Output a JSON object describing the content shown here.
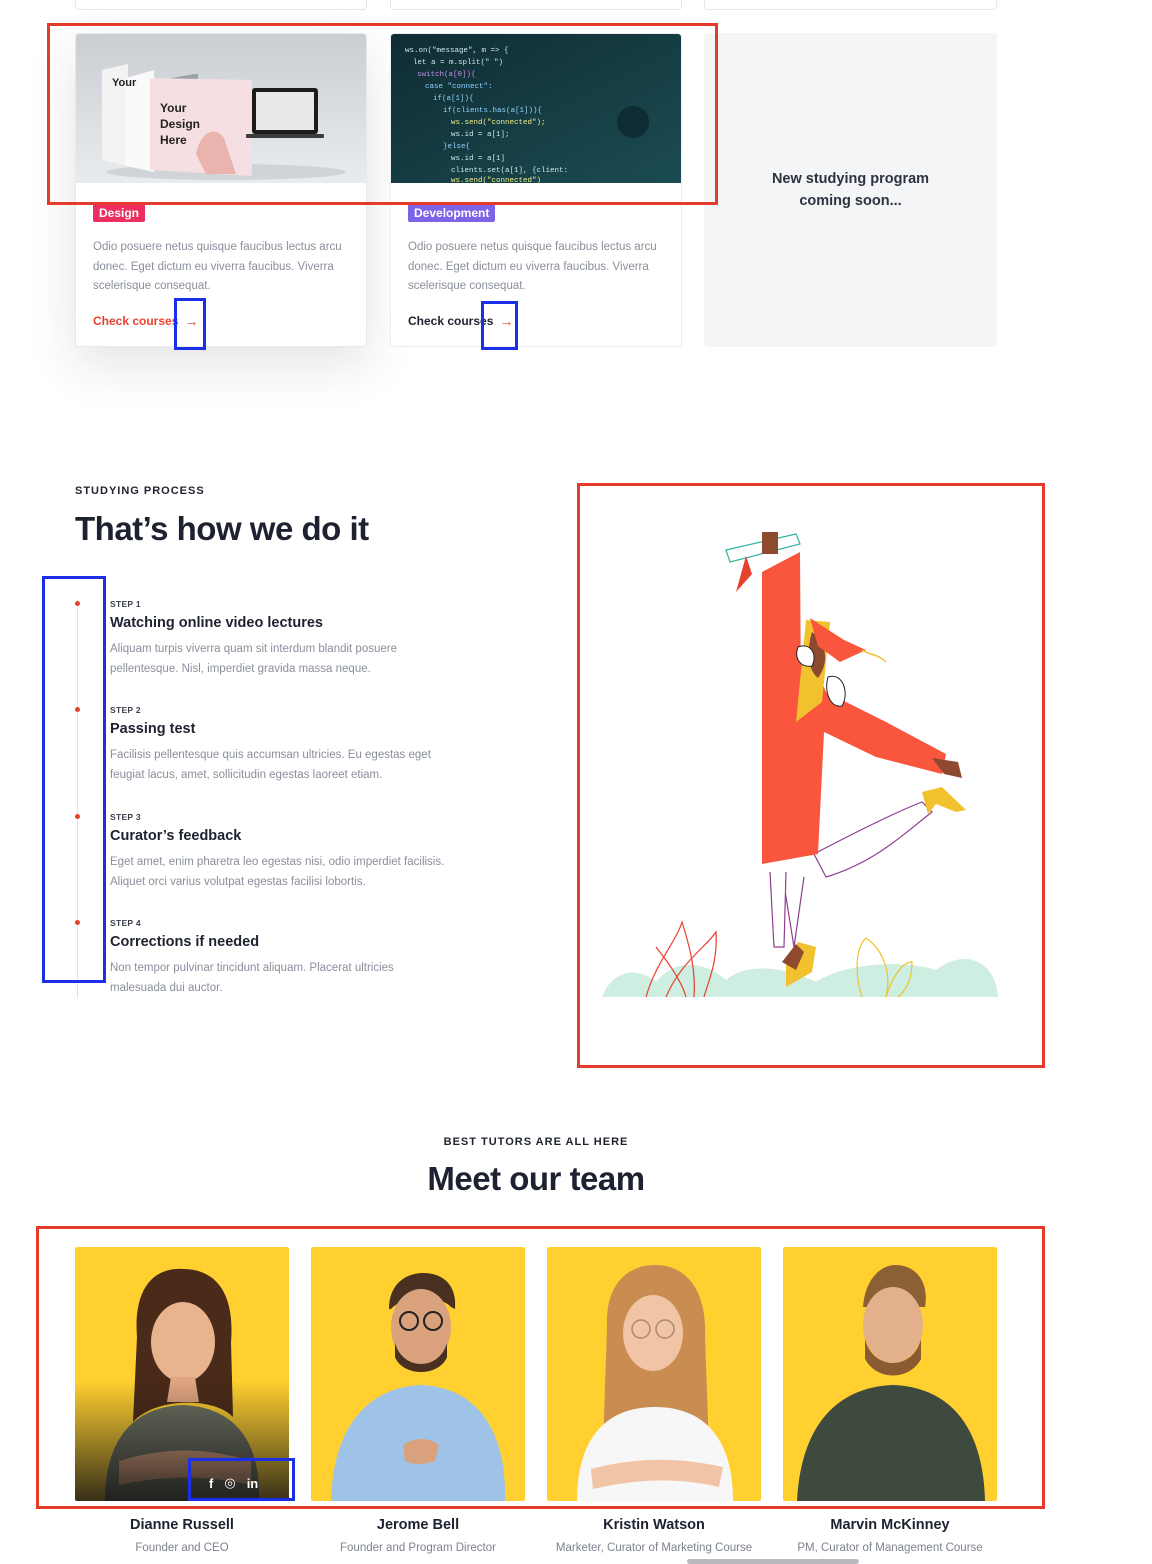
{
  "courses": [
    {
      "tag": "Design",
      "tag_color": "#ec2f5f",
      "desc": "Odio posuere netus quisque faucibus lectus arcu donec. Eget dictum eu viverra faucibus. Viverra scelerisque consequat.",
      "cta": "Check courses",
      "thumb_text": [
        "Your",
        "Design",
        "Here"
      ]
    },
    {
      "tag": "Development",
      "tag_color": "#7c63e8",
      "desc": "Odio posuere netus quisque faucibus lectus arcu donec. Eget dictum eu viverra faucibus. Viverra scelerisque consequat.",
      "cta": "Check courses"
    }
  ],
  "coming_soon": "New studying program coming soon...",
  "process": {
    "eyebrow": "STUDYING PROCESS",
    "title": "That’s how we do it",
    "steps": [
      {
        "label": "STEP 1",
        "title": "Watching online video lectures",
        "text": "Aliquam turpis viverra quam sit interdum blandit posuere pellentesque. Nisl, imperdiet gravida massa neque."
      },
      {
        "label": "STEP 2",
        "title": "Passing test",
        "text": "Facilisis pellentesque quis accumsan ultricies. Eu egestas eget feugiat lacus, amet, sollicitudin egestas laoreet etiam."
      },
      {
        "label": "STEP 3",
        "title": "Curator’s feedback",
        "text": "Eget amet, enim pharetra leo egestas nisi, odio imperdiet facilisis. Aliquet orci varius volutpat egestas facilisi lobortis."
      },
      {
        "label": "STEP 4",
        "title": "Corrections if needed",
        "text": "Non tempor pulvinar tincidunt aliquam. Placerat ultricies malesuada dui auctor."
      }
    ]
  },
  "team": {
    "eyebrow": "BEST TUTORS ARE ALL HERE",
    "title": "Meet our team",
    "members": [
      {
        "name": "Dianne Russell",
        "role": "Founder and CEO"
      },
      {
        "name": "Jerome Bell",
        "role": "Founder and Program Director"
      },
      {
        "name": "Kristin Watson",
        "role": "Marketer, Curator of Marketing Course"
      },
      {
        "name": "Marvin McKinney",
        "role": "PM, Curator of Management Course"
      }
    ],
    "social": [
      "f",
      "◎",
      "in"
    ]
  },
  "colors": {
    "accent": "#e8402e",
    "team_bg": "#ffd02f",
    "highlight_red": "#e43b2c",
    "highlight_blue": "#1c2fe8"
  }
}
